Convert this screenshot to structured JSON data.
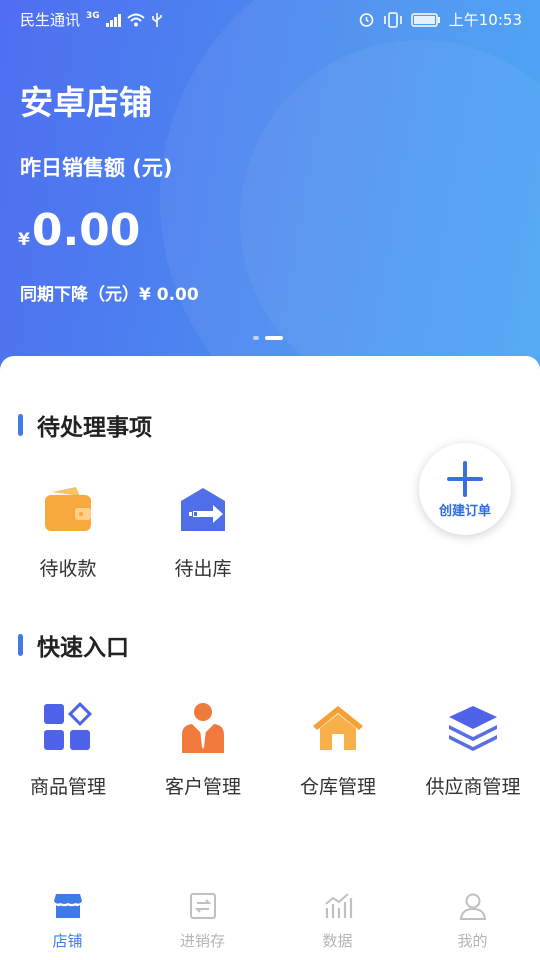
{
  "status_bar": {
    "carrier": "民生通讯",
    "network": "3G",
    "time": "上午10:53"
  },
  "header": {
    "store_name": "安卓店铺",
    "sales_label": "昨日销售额 (元)",
    "currency": "¥",
    "amount": "0.00",
    "compare_label": "同期下降（元）¥ 0.00",
    "carousel_pages": 2,
    "carousel_active": 2
  },
  "pending": {
    "title": "待处理事项",
    "items": [
      {
        "label": "待收款",
        "icon": "wallet-icon"
      },
      {
        "label": "待出库",
        "icon": "outbound-icon"
      }
    ]
  },
  "create_order": {
    "label": "创建订单",
    "icon": "plus-icon"
  },
  "quick": {
    "title": "快速入口",
    "items": [
      {
        "label": "商品管理",
        "icon": "apps-grid-icon"
      },
      {
        "label": "客户管理",
        "icon": "customer-icon"
      },
      {
        "label": "仓库管理",
        "icon": "warehouse-icon"
      },
      {
        "label": "供应商管理",
        "icon": "layers-icon"
      }
    ]
  },
  "tabbar": {
    "tabs": [
      {
        "label": "店铺",
        "icon": "store-icon",
        "active": true
      },
      {
        "label": "进销存",
        "icon": "inventory-icon",
        "active": false
      },
      {
        "label": "数据",
        "icon": "chart-icon",
        "active": false
      },
      {
        "label": "我的",
        "icon": "user-icon",
        "active": false
      }
    ]
  },
  "colors": {
    "accent": "#3f7be8",
    "header_start": "#4f6ef0",
    "header_end": "#43a3f5",
    "inactive_tab": "#b5b5b5"
  }
}
